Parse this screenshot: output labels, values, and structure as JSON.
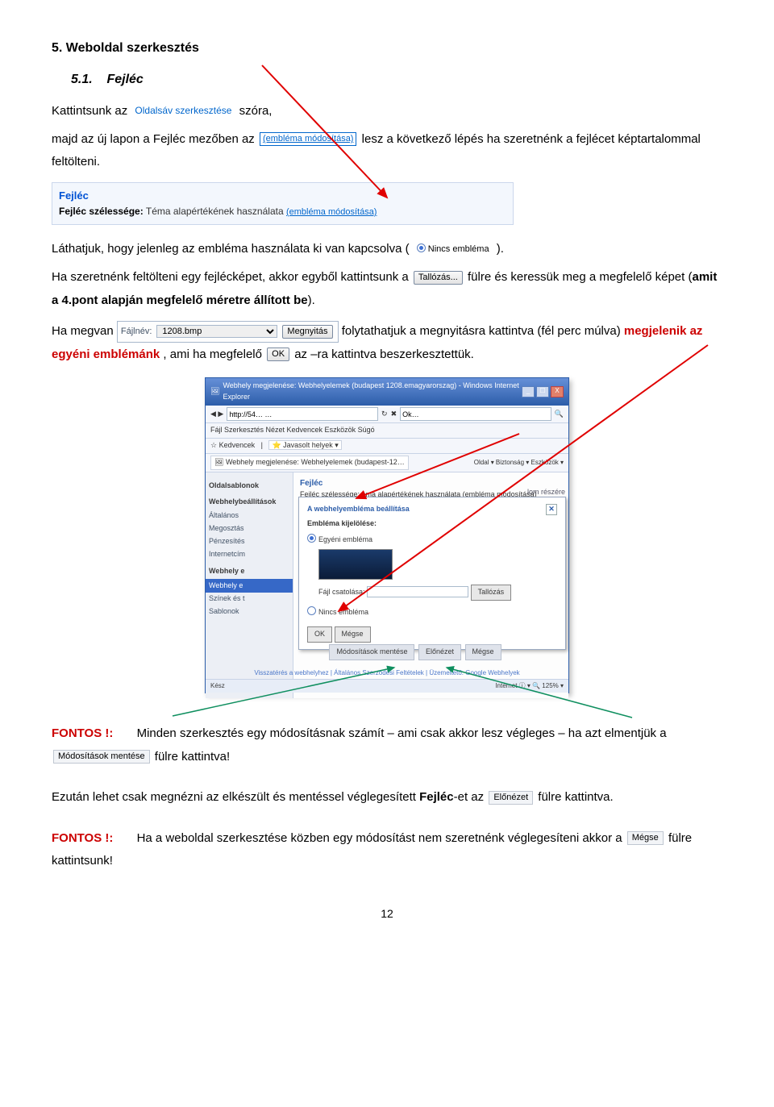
{
  "sec_no": "5.",
  "sec_title": "Weboldal szerkesztés",
  "sub_no": "5.1.",
  "sub_title": "Fejléc",
  "p1a": "Kattintsunk az ",
  "link_oldalsav": "Oldalsáv szerkesztése",
  "p1b": " szóra,",
  "p2a": "majd az új lapon a Fejléc mezőben az  ",
  "link_emblema_modositasa": "(embléma módosítása)",
  "p2b": "  lesz a következő lépés ha szeretnénk a fejlécet képtartalommal feltölteni.",
  "box_fejlec_title": "Fejléc",
  "box_fejlec_label": "Fejléc szélessége:",
  "box_fejlec_value": "Téma alapértékének használata",
  "p3a": "Láthatjuk, hogy jelenleg az embléma használata ki van kapcsolva ( ",
  "nincs_emblema": "Nincs embléma",
  "p3b": " ).",
  "p4a": "Ha szeretnénk feltölteni egy fejlécképet, akkor egyből kattintsunk a ",
  "btn_tallozas": "Tallózás...",
  "p4b": " fülre és keressük meg a megfelelő képet (",
  "p4c": "amit a 4.pont alapján megfelelő méretre állított be",
  "p4d": ").",
  "p5a": "Ha megvan  ",
  "file_label": "Fájlnév:",
  "file_value": "1208.bmp",
  "file_open": "Megnyitás",
  "p5b": "  folytathatjuk a megnyitásra kattintva (fél perc múlva) ",
  "p5red": "megjelenik az egyéni emblémánk",
  "p5c": ", ami ha megfelelő  ",
  "btn_ok": "OK",
  "p5d": "  az –ra kattintva beszerkesztettük.",
  "sc_title": "Webhely megjelenése: Webhelyelemek (budapest 1208.emagyarorszag) - Windows Internet Explorer",
  "sc_addr": "http://54… …",
  "sc_search": "Ok…",
  "sc_menu": "Fájl   Szerkesztés   Nézet   Kedvencek   Eszközök   Súgó",
  "sc_fav1": "Kedvencek",
  "sc_fav2": "Javasolt helyek",
  "sc_tab": "Webhely megjelenése: Webhelyelemek (budapest-12…",
  "sc_tools": "Oldal ▾   Biztonság ▾   Eszközök ▾ ",
  "sb_section1": "Oldalsablonok",
  "sb_section2": "Webhelybeállítások",
  "sb_items": [
    "Általános",
    "Megosztás",
    "Pénzesítés",
    "Internetcím"
  ],
  "sb_section3": "Webhely e",
  "sb_sel": "Webhely e",
  "sb_items2": [
    "Színek és t",
    "Sablonok"
  ],
  "main_sec": "Fejléc",
  "main_line": "Fejléc szélessége:   ema alapértékének használata (embléma módosítása)",
  "main_side": "lom részére",
  "dlg_title": "A webhelyembléma beállítása",
  "dlg_label": "Embléma kijelölése:",
  "dlg_opt1": "Egyéni embléma",
  "dlg_file_label": "Fájl csatolása:",
  "dlg_tallozas": "Tallózás",
  "dlg_opt2": "Nincs embléma",
  "dlg_ok": "OK",
  "dlg_megse": "Mégse",
  "bb1": "Módosítások mentése",
  "bb2": "Előnézet",
  "bb3": "Mégse",
  "sc_footer": "Visszatérés a webhelyhez  |  Általános Szerződési Feltételek  |  Üzemeltető: Google Webhelyek",
  "sc_status_l": "Kész",
  "sc_status_r": "Internet        ⓘ ▾   🔍 125% ▾",
  "fontos": "FONTOS !:",
  "f1a": "Minden szerkesztés egy módosításnak számít – ami csak akkor lesz végleges – ha azt elmentjük a ",
  "chip_mentes": "Módosítások mentése",
  "f1b": " fülre kattintva!",
  "p6a": "Ezután lehet csak megnézni az elkészült és mentéssel véglegesített ",
  "p6bold": "Fejléc",
  "p6b": "-et az ",
  "chip_elonezet": "Előnézet",
  "p6c": " fülre kattintva.",
  "f2a": "Ha a weboldal szerkesztése közben egy módosítást nem szeretnénk véglegesíteni akkor a ",
  "chip_megse": "Mégse",
  "f2b": " fülre kattintsunk!",
  "page": "12"
}
